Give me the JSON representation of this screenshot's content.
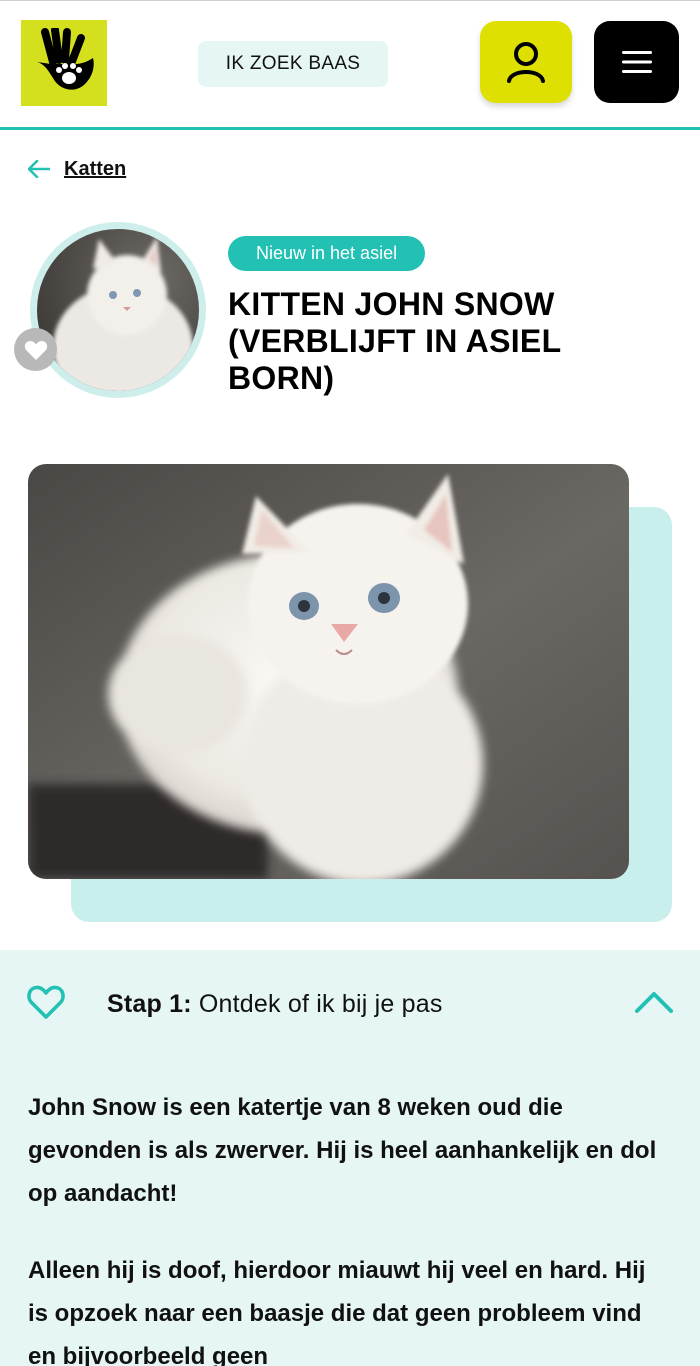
{
  "header": {
    "search_label": "IK ZOEK BAAS",
    "colors": {
      "accent": "#22c1b4",
      "logo_bg": "#d4e01e",
      "account_bg": "#dde000",
      "menu_bg": "#000000"
    }
  },
  "breadcrumb": {
    "back_label": "Katten"
  },
  "animal": {
    "badge": "Nieuw in het asiel",
    "title": "KITTEN JOHN SNOW (VERBLIJFT IN ASIEL BORN)"
  },
  "step": {
    "number_label": "Stap 1:",
    "text": "Ontdek of ik bij je pas",
    "expanded": true
  },
  "description": {
    "paragraph_1": "John Snow is een katertje van 8 weken oud die gevonden is als zwerver. Hij is heel aanhankelijk en dol op aandacht!",
    "paragraph_2": "Alleen hij is doof, hierdoor miauwt hij veel en hard. Hij is opzoek naar een baasje die dat geen probleem vind en bijvoorbeeld geen"
  },
  "icons": {
    "logo": "hand-paw-logo",
    "account": "user-icon",
    "menu": "hamburger-menu-icon",
    "back": "arrow-left-icon",
    "favorite": "heart-icon",
    "step": "heart-outline-icon",
    "collapse": "chevron-up-icon"
  }
}
